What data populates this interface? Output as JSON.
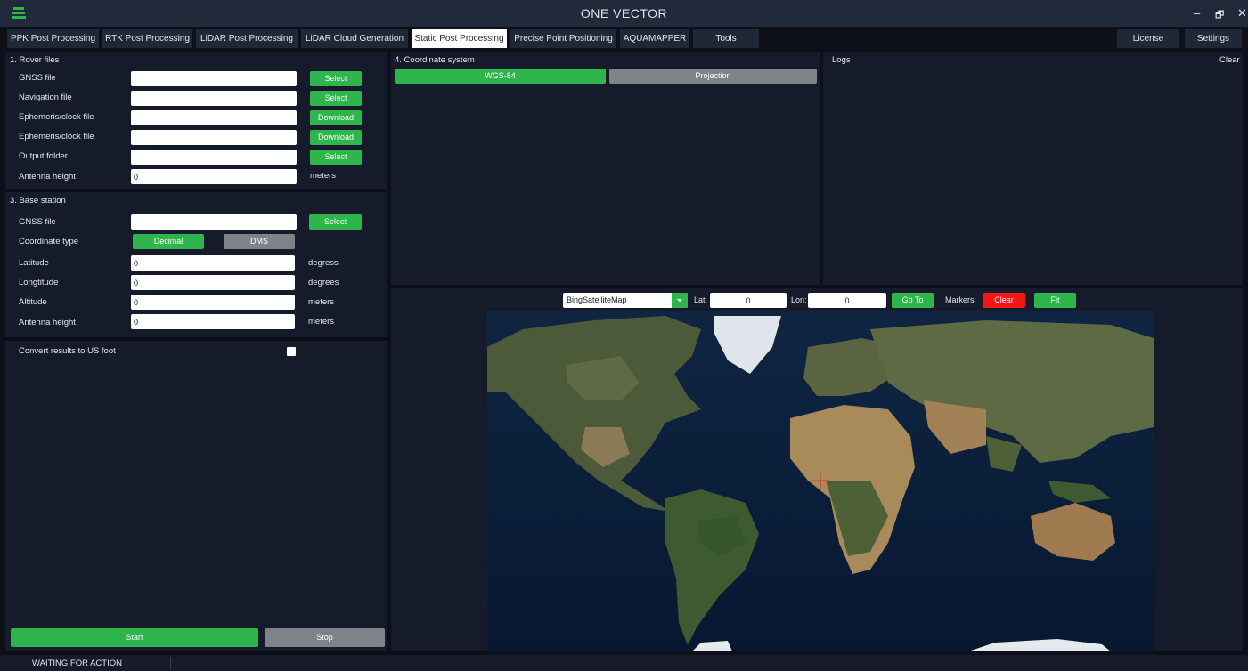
{
  "app": {
    "title": "ONE VECTOR",
    "minimize": "–",
    "restore": "🗗",
    "close": "✕"
  },
  "tabs": [
    {
      "label": "PPK Post Processing"
    },
    {
      "label": "RTK Post Processing"
    },
    {
      "label": "LiDAR Post Processing"
    },
    {
      "label": "LiDAR Cloud Generation"
    },
    {
      "label": "Static Post Processing",
      "active": true
    },
    {
      "label": "Precise Point Positioning"
    },
    {
      "label": "AQUAMAPPER"
    },
    {
      "label": "Tools"
    }
  ],
  "right_tabs": {
    "license": "License",
    "settings": "Settings"
  },
  "rover": {
    "title": "1. Rover files",
    "gnss_label": "GNSS file",
    "gnss_value": "",
    "gnss_button": "Select",
    "nav_label": "Navigation file",
    "nav_value": "",
    "nav_button": "Select",
    "eph1_label": "Ephemeris/clock file",
    "eph1_value": "",
    "eph1_button": "Download",
    "eph2_label": "Ephemeris/clock file",
    "eph2_value": "",
    "eph2_button": "Download",
    "out_label": "Output folder",
    "out_value": "",
    "out_button": "Select",
    "ant_label": "Antenna height",
    "ant_value": "0",
    "ant_unit": "meters"
  },
  "base": {
    "title": "3. Base station",
    "gnss_label": "GNSS file",
    "gnss_value": "",
    "gnss_button": "Select",
    "coord_type_label": "Coordinate type",
    "decimal": "Decimal",
    "dms": "DMS",
    "lat_label": "Latitude",
    "lat_value": "0",
    "lat_unit": "degress",
    "lon_label": "Longtitude",
    "lon_value": "0",
    "lon_unit": "degrees",
    "alt_label": "Altitude",
    "alt_value": "0",
    "alt_unit": "meters",
    "ant_label": "Antenna height",
    "ant_value": "0",
    "ant_unit": "meters"
  },
  "convert": {
    "label": "Convert results to US foot",
    "checked": false
  },
  "actions": {
    "start": "Start",
    "stop": "Stop"
  },
  "coordsys": {
    "title": "4. Coordinate system",
    "wgs": "WGS-84",
    "projection": "Projection"
  },
  "logs": {
    "title": "Logs",
    "clear": "Clear"
  },
  "maptoolbar": {
    "map_select": "BingSatelliteMap",
    "lat_label": "Lat:",
    "lat_value": "0",
    "lon_label": "Lon:",
    "lon_value": "0",
    "goto": "Go To",
    "markers_label": "Markers:",
    "clear": "Clear",
    "fit": "Fit"
  },
  "status": {
    "text": "WAITING FOR ACTION"
  },
  "colors": {
    "accent_green": "#2eb54c",
    "danger_red": "#f21818",
    "panel": "#151b2a",
    "background": "#0d0f19"
  }
}
